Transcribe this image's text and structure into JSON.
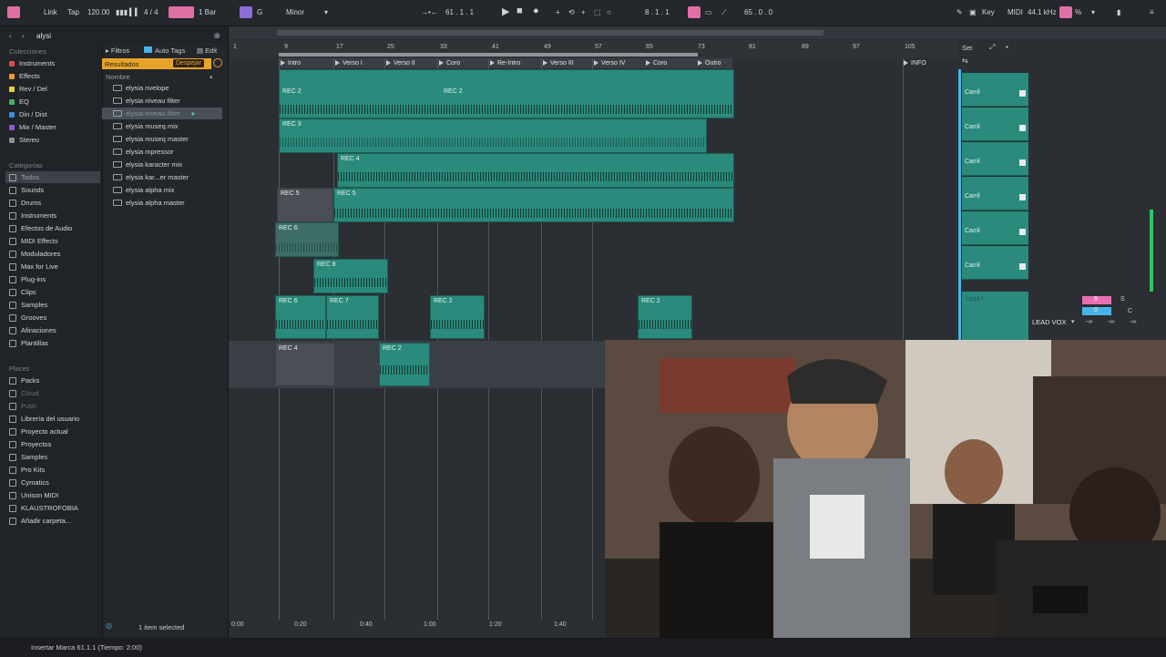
{
  "top": {
    "link": "Link",
    "tap": "Tap",
    "tempo": "120.00",
    "signature": "4 / 4",
    "quantize": "1 Bar",
    "key": "G",
    "scale": "Minor",
    "position": "61 .   1 .   1",
    "loop_start": "8 .   1 .   1",
    "loop_length": "65 .   0 .   0",
    "key_btn": "Key",
    "midi_btn": "MIDI",
    "sample_rate": "44.1 kHz",
    "cpu": "%"
  },
  "browser": {
    "search": "alysi",
    "collections_header": "Colecciones",
    "collections": [
      {
        "label": "Instruments",
        "color": "#e04848"
      },
      {
        "label": "Effects",
        "color": "#e79a2e"
      },
      {
        "label": "Rev / Del",
        "color": "#e8d33a"
      },
      {
        "label": "EQ",
        "color": "#44b35c"
      },
      {
        "label": "Din / Dist",
        "color": "#3a8fe0"
      },
      {
        "label": "Mix / Master",
        "color": "#8a5ad6"
      },
      {
        "label": "Stereo",
        "color": "#8a8f96"
      }
    ],
    "categories_header": "Categorías",
    "categories": [
      "Todos",
      "Sounds",
      "Drums",
      "Instruments",
      "Efectos de Audio",
      "MIDI Effects",
      "Moduladores",
      "Max for Live",
      "Plug-ins",
      "Clips",
      "Samples",
      "Grooves",
      "Afinaciones",
      "Plantillas"
    ],
    "places_header": "Places",
    "places": [
      "Packs",
      "Cloud",
      "Push",
      "Librería del usuario",
      "Proyecto actual",
      "Proyectos",
      "Samples",
      "Pro Kits",
      "Cymatics",
      "Unison MIDI",
      "KLAUSTROFOBIA",
      "Añadir carpeta..."
    ],
    "filters_btn": "Filtros",
    "autotags_btn": "Auto Tags",
    "edit_btn": "Edit",
    "results_label": "Resultados",
    "clear_btn": "Despejar",
    "name_col": "Nombre",
    "results": [
      "elysia nvelope",
      "elysia niveau filter",
      "elysia niveau filter",
      "elysia museq mix",
      "elysia museq master",
      "elysia mpressor",
      "elysia karacter mix",
      "elysia kar...er master",
      "elysia alpha mix",
      "elysia alpha master"
    ],
    "selected_count": "1 item selected"
  },
  "arrangement": {
    "ruler": [
      "1",
      "9",
      "17",
      "25",
      "33",
      "41",
      "49",
      "57",
      "65",
      "73",
      "81",
      "89",
      "97",
      "105"
    ],
    "locators": [
      "Intro",
      "Verso I",
      "Verso II",
      "Coro",
      "Re-Intro",
      "Verso III",
      "Verso IV",
      "Coro",
      "Outro",
      "INFO"
    ],
    "clips": {
      "rec2a": "REC 2",
      "rec2b": "REC 2",
      "rec3": "REC 3",
      "rec4": "REC 4",
      "rec5a": "REC 5",
      "rec5b": "REC 5",
      "rec6": "REC 6",
      "rec8": "REC 8",
      "rec6b": "REC 6",
      "rec7": "REC 7",
      "rec2c": "REC 2",
      "rec2d": "REC 2",
      "rec4b": "REC 4",
      "rec2e": "REC 2"
    },
    "times": [
      "0:00",
      "0:20",
      "0:40",
      "1:00",
      "1:20",
      "1:40"
    ]
  },
  "session": {
    "set_label": "Set",
    "scenes": [
      "Carril",
      "Carril",
      "Carril",
      "Carril",
      "Carril",
      "Carril"
    ],
    "lead_clip": "Lead I",
    "track_name": "LEAD VOX",
    "vol": "5",
    "s_btn": "S",
    "pan": "0",
    "c_btn": "C",
    "inf1": "-∞",
    "inf2": "-∞",
    "inf3": "-∞"
  },
  "status": {
    "message": "Insertar Marca 61.1.1 (Tiempo: 2:00)"
  }
}
